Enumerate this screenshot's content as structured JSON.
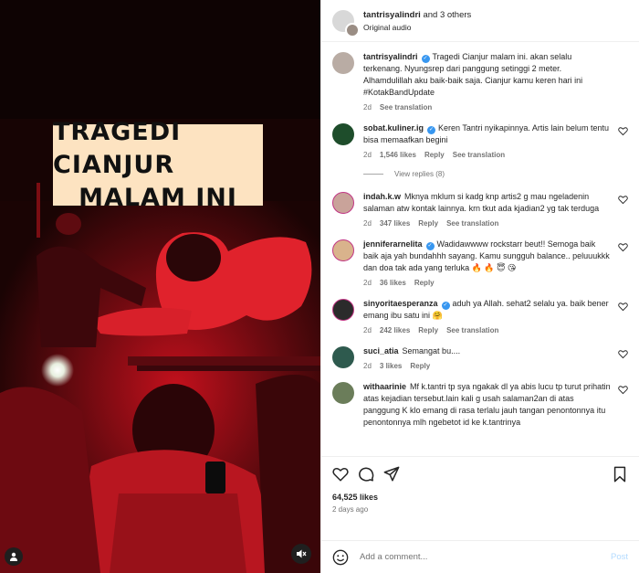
{
  "media": {
    "overlay_line1": "TRAGEDI CIANJUR",
    "overlay_line2": "MALAM INI"
  },
  "header": {
    "user": "tantrisyalindri",
    "and_others": "and 3 others",
    "audio": "Original audio"
  },
  "caption": {
    "user": "tantrisyalindri",
    "text": "Tragedi Cianjur malam ini. akan selalu terkenang. Nyungsrep dari panggung setinggi 2 meter. Alhamdulillah aku baik-baik saja. Cianjur kamu keren hari ini #KotakBandUpdate",
    "time": "2d",
    "see_translation": "See translation"
  },
  "comments": [
    {
      "user": "sobat.kuliner.ig",
      "verified": true,
      "text": "Keren Tantri nyikapinnya. Artis lain belum tentu bisa memaafkan begini",
      "time": "2d",
      "likes": "1,546 likes",
      "reply": "Reply",
      "see_translation": "See translation",
      "view_replies": "View replies (8)",
      "avatar_color": "#1e4d2b"
    },
    {
      "user": "indah.k.w",
      "verified": false,
      "text": "Mknya mklum si kadg knp artis2 g mau ngeladenin salaman atw kontak lainnya. krn tkut ada kjadian2 yg tak terduga",
      "time": "2d",
      "likes": "347 likes",
      "reply": "Reply",
      "see_translation": "See translation",
      "avatar_color": "#c9a39a"
    },
    {
      "user": "jenniferarnelita",
      "verified": true,
      "text": "Wadidawwww rockstarr beut!! Semoga baik baik aja yah bundahhh sayang. Kamu sungguh balance.. peluuukkk dan doa tak ada yang terluka 🔥 🔥 😇 😘",
      "time": "2d",
      "likes": "36 likes",
      "reply": "Reply",
      "avatar_color": "#d9b38c"
    },
    {
      "user": "sinyoritaesperanza",
      "verified": true,
      "text": "aduh ya Allah. sehat2 selalu ya. baik bener emang ibu satu ini 🤗",
      "time": "2d",
      "likes": "242 likes",
      "reply": "Reply",
      "see_translation": "See translation",
      "avatar_color": "#2b2b2b"
    },
    {
      "user": "suci_atia",
      "verified": false,
      "text": "Semangat bu....",
      "time": "2d",
      "likes": "3 likes",
      "reply": "Reply",
      "avatar_color": "#2e5a4e"
    },
    {
      "user": "withaarinie",
      "verified": false,
      "text": "Mf k.tantri tp sya ngakak dl ya abis lucu tp turut prihatin atas kejadian tersebut.lain kali g usah salaman2an di atas panggung K klo emang di rasa terlalu jauh tangan penontonnya itu penontonnya mlh ngebetot id ke k.tantrinya",
      "avatar_color": "#6b7d5a"
    }
  ],
  "footer": {
    "likes": "64,525 likes",
    "ago": "2 days ago",
    "add_comment_placeholder": "Add a comment...",
    "post": "Post"
  }
}
